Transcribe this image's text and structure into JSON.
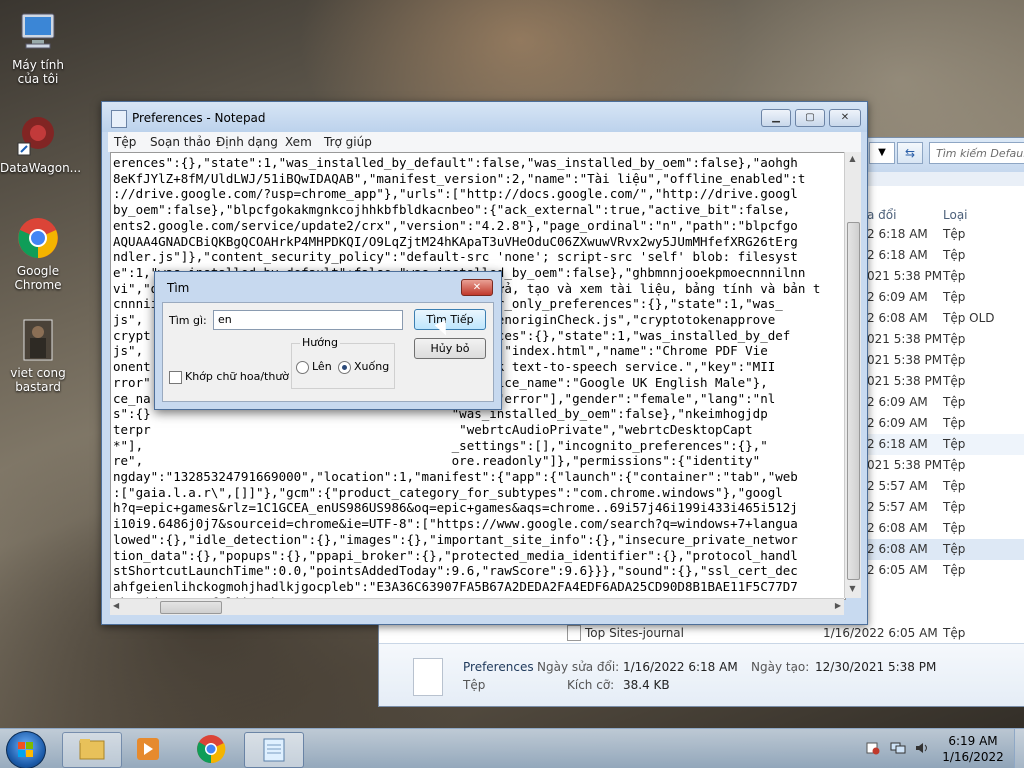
{
  "desktop": {
    "icons": [
      {
        "label": "Máy tính của tôi"
      },
      {
        "label": "DataWagon..."
      },
      {
        "label": "Google Chrome"
      },
      {
        "label": "viet cong bastard"
      }
    ]
  },
  "explorer": {
    "search_placeholder": "Tìm kiếm Default",
    "col_date": "a đổi",
    "col_type": "Loại",
    "rows": [
      {
        "date": "2 6:18 AM",
        "type": "Tệp"
      },
      {
        "date": "2 6:18 AM",
        "type": "Tệp"
      },
      {
        "date": "021 5:38 PM",
        "type": "Tệp"
      },
      {
        "date": "2 6:09 AM",
        "type": "Tệp"
      },
      {
        "date": "2 6:08 AM",
        "type": "Tệp OLD"
      },
      {
        "date": "021 5:38 PM",
        "type": "Tệp"
      },
      {
        "date": "021 5:38 PM",
        "type": "Tệp"
      },
      {
        "date": "021 5:38 PM",
        "type": "Tệp"
      },
      {
        "date": "2 6:09 AM",
        "type": "Tệp"
      },
      {
        "date": "2 6:09 AM",
        "type": "Tệp"
      },
      {
        "date": "2 6:18 AM",
        "type": "Tệp"
      },
      {
        "date": "021 5:38 PM",
        "type": "Tệp"
      },
      {
        "date": "2 5:57 AM",
        "type": "Tệp"
      },
      {
        "date": "2 5:57 AM",
        "type": "Tệp"
      },
      {
        "date": "2 6:08 AM",
        "type": "Tệp"
      },
      {
        "date": "2 6:08 AM",
        "type": "Tệp"
      },
      {
        "date": "2 6:05 AM",
        "type": "Tệp"
      }
    ],
    "last_row": {
      "name": "Top Sites-journal",
      "date": "1/16/2022 6:05 AM",
      "type": "Tệp"
    },
    "details": {
      "name": "Preferences",
      "type": "Tệp",
      "modified_label": "Ngày sửa đổi:",
      "modified": "1/16/2022 6:18 AM",
      "created_label": "Ngày tạo:",
      "created": "12/30/2021 5:38 PM",
      "size_label": "Kích cỡ:",
      "size": "38.4 KB"
    }
  },
  "notepad": {
    "title": "Preferences - Notepad",
    "menu": [
      "Tệp",
      "Soạn thảo",
      "Định dạng",
      "Xem",
      "Trợ giúp"
    ],
    "lines": [
      "erences\":{},\"state\":1,\"was_installed_by_default\":false,\"was_installed_by_oem\":false},\"aohgh",
      "8eKfJYlZ+8fM/UldLWJ/51iBQwIDAQAB\",\"manifest_version\":2,\"name\":\"Tài liệu\",\"offline_enabled\":t",
      "://drive.google.com/?usp=chrome_app\"},\"urls\":[\"http://docs.google.com/\",\"http://drive.googl",
      "by_oem\":false},\"blpcfgokakmgnkcojhhkbfbldkacnbeo\":{\"ack_external\":true,\"active_bit\":false,",
      "ents2.google.com/service/update2/crx\",\"version\":\"4.2.8\"},\"page_ordinal\":\"n\",\"path\":\"blpcfgo",
      "AQUAA4GNADCBiQKBgQCOAHrkP4MHPDKQI/O9LqZjtM24hKApaT3uVHeOduC06ZXwuwVRvx2wy5JUmMHfefXRG26tErg",
      "ndler.js\"]},\"content_security_policy\":\"default-src 'none'; script-src 'self' blob: filesyst",
      "e\":1,\"was_installed_by_default\":false,\"was_installed_by_oem\":false},\"ghbmnnjooekpmoecnnnilnn",
      "vi\",\"default_locale\":\"en_US\",\"description\":\"Chỉnh sửa, tạo và xem tài liệu, bảng tính và bản t",
      "cnnnii                                        egular_only_preferences\":{},\"state\":1,\"was_",
      "js\",                                         ototokenoriginCheck.js\",\"cryptotokenapprove",
      "crypt                                         ferences\":{},\"state\":1,\"was_installed_by_def",
      "js\",                                         ndler\":\"index.html\",\"name\":\"Chrome PDF Vie",
      "onent                                         etwork text-to-speech service.\",\"key\":\"MII",
      "rror\"                                        ue,\"voice_name\":\"Google UK English Male\"},",
      "ce_na                                         end\",\"error\"],\"gender\":\"female\",\"lang\":\"nl",
      "s\":{}                                        \"was_installed_by_oem\":false},\"nkeimhogjdp",
      "terpr                                         \"webrtcAudioPrivate\",\"webrtcDesktopCapt",
      "*\"],                                         _settings\":[],\"incognito_preferences\":{},\"",
      "re\",                                         ore.readonly\"]},\"permissions\":{\"identity\"",
      "ngday\":\"13285324791669000\",\"location\":1,\"manifest\":{\"app\":{\"launch\":{\"container\":\"tab\",\"web",
      ":[\"gaia.l.a.r\\\",[]]\"},\"gcm\":{\"product_category_for_subtypes\":\"com.chrome.windows\"},\"googl",
      "h?q=epic+games&rlz=1C1GCEA_enUS986US986&oq=epic+games&aqs=chrome..69i57j46i199i433i465i512j",
      "i10i9.6486j0j7&sourceid=chrome&ie=UTF-8\":[\"https://www.google.com/search?q=windows+7+langua",
      "lowed\":{},\"idle_detection\":{},\"images\":{},\"important_site_info\":{},\"insecure_private_networ",
      "tion_data\":{},\"popups\":{},\"ppapi_broker\":{},\"protected_media_identifier\":{},\"protocol_handl",
      "stShortcutLaunchTime\":0.0,\"pointsAddedToday\":9.6,\"rawScore\":9.6}}},\"sound\":{},\"ssl_cert_dec",
      "ahfgeienlihckogmohjhadlkjgocpleb\":\"E3A36C63907FA5B67A2DEDA2FA4EDF6ADA25CD90D8B1BAE11F5C77D7",
      "mhogjdpnpccoofpliimaahmaaome\":\"9EC3B2516E2F9AC508034E53E6D2A02C3F82C0A3702B09DDDBCE25E128E8",
      "5A57B3\",\"pinned_tabs\":\"A3DD42BF22EEE51FE445353A507DF684E4DA395E6F3D8AB82E05CA2409FA81AC\",\"p",
      "43D76BC9D041F3169EE0A9529FFB05048CB9247D2403789E44E4\",\"prompt_version\":\"232652CF6A44ECAB731",
      "\":\"13286804726158050\",\"type\":2,\"window_count\":1},{\"crashed\":false,\"time\":\"13286804891694617",
      "\"apdfllckaahabafndbhieahigkjlhalf\":{\"cohort\":\"1::\",\"cohortname\":\"\",\"dlrc\":5494,\"pf\":\"6cc",
      "tem_web_app_last_update\":\"97.0.4692.71\"},\"zerosuggest\":{\"cachedresults\":\")]}'\\n[\\\"\",[],[],"
    ]
  },
  "find": {
    "title": "Tìm",
    "find_label": "Tìm gì:",
    "find_value": "en",
    "find_next": "Tìm Tiếp",
    "cancel": "Hủy bỏ",
    "direction_label": "Hướng",
    "up": "Lên",
    "down": "Xuống",
    "match_case": "Khớp chữ hoa/thường"
  },
  "taskbar": {
    "time": "6:19 AM",
    "date": "1/16/2022"
  }
}
